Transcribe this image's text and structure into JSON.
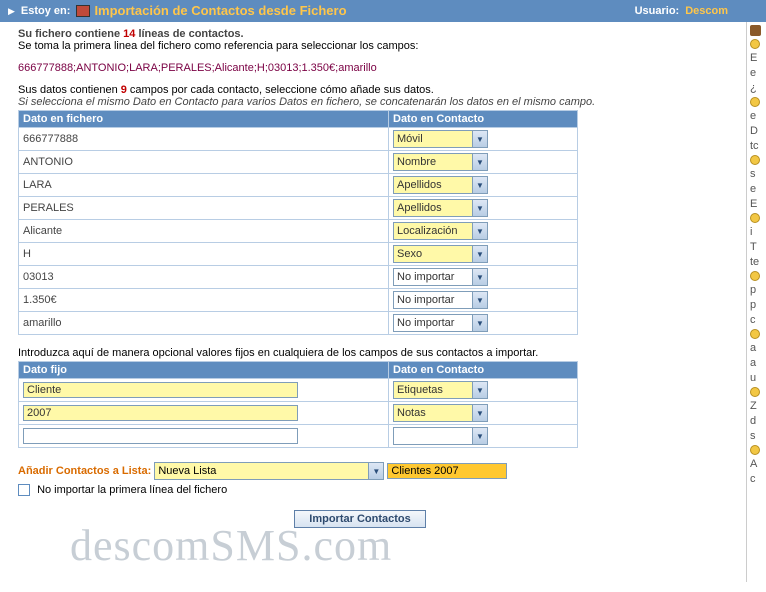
{
  "topbar": {
    "estoy": "Estoy en:",
    "title": "Importación de Contactos desde Fichero",
    "usuario_lbl": "Usuario:",
    "usuario_val": "Descom"
  },
  "summary": {
    "prefix": "Su fichero contiene ",
    "count": "14",
    "suffix": " líneas de contactos.",
    "line2": "Se toma la primera linea del fichero como referencia para seleccionar los campos:",
    "sample": "666777888;ANTONIO;LARA;PERALES;Alicante;H;03013;1.350€;amarillo",
    "fields_prefix": "Sus datos contienen ",
    "fields_count": "9",
    "fields_suffix": " campos por cada contacto, seleccione cómo añade sus datos.",
    "concat_note": "Si selecciona el mismo Dato en Contacto para varios Datos en fichero, se concatenarán los datos en el mismo campo."
  },
  "map_headers": {
    "file": "Dato en fichero",
    "contact": "Dato en Contacto"
  },
  "map_rows": [
    {
      "file": "666777888",
      "contact": "Móvil",
      "highlight": true
    },
    {
      "file": "ANTONIO",
      "contact": "Nombre",
      "highlight": true
    },
    {
      "file": "LARA",
      "contact": "Apellidos",
      "highlight": true
    },
    {
      "file": "PERALES",
      "contact": "Apellidos",
      "highlight": true
    },
    {
      "file": "Alicante",
      "contact": "Localización",
      "highlight": true
    },
    {
      "file": "H",
      "contact": "Sexo",
      "highlight": true
    },
    {
      "file": "03013",
      "contact": "No importar",
      "highlight": false
    },
    {
      "file": "1.350€",
      "contact": "No importar",
      "highlight": false
    },
    {
      "file": "amarillo",
      "contact": "No importar",
      "highlight": false
    }
  ],
  "fixed_intro": "Introduzca aquí de manera opcional valores fijos en cualquiera de los campos de sus contactos a importar.",
  "fixed_headers": {
    "value": "Dato fijo",
    "contact": "Dato en Contacto"
  },
  "fixed_rows": [
    {
      "value": "Cliente",
      "contact": "Etiquetas",
      "highlight": true
    },
    {
      "value": "2007",
      "contact": "Notas",
      "highlight": true
    },
    {
      "value": "",
      "contact": "",
      "highlight": false
    }
  ],
  "addlist": {
    "label": "Añadir Contactos a Lista:",
    "selected": "Nueva Lista",
    "newname": "Clientes 2007"
  },
  "checkbox_label": "No importar la primera línea del fichero",
  "button": "Importar Contactos",
  "watermark": "descomSMS.com",
  "rightletters": [
    "E",
    "e",
    "¿",
    "e",
    "D",
    "tc",
    "s",
    "e",
    "E",
    "i",
    "T",
    "te",
    "p",
    "p",
    "c",
    "a",
    "a",
    "u",
    "Z",
    "d",
    "s",
    "A",
    "c"
  ]
}
